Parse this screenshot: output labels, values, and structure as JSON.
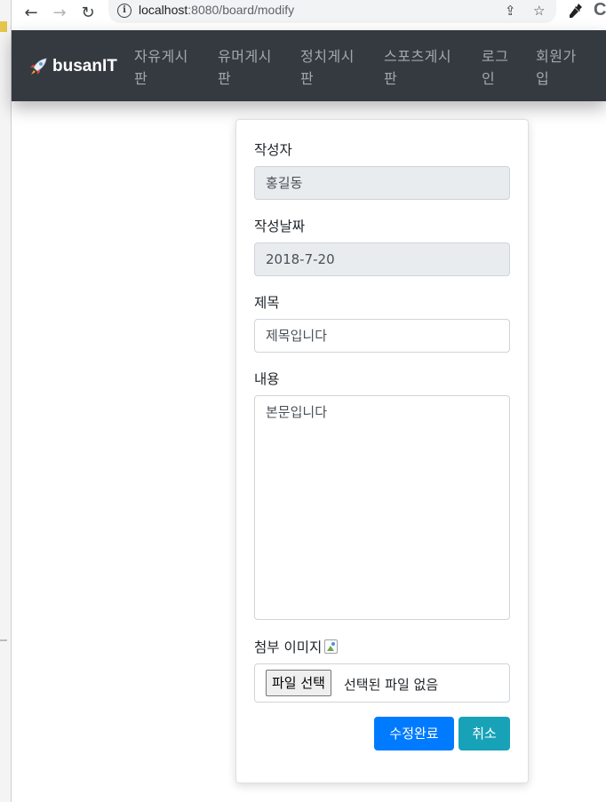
{
  "browser": {
    "url_host": "localhost",
    "url_rest": ":8080/board/modify",
    "icons": [
      "back-icon",
      "forward-icon",
      "reload-icon",
      "info-icon",
      "share-icon",
      "star-icon",
      "eyedropper-icon"
    ],
    "extension_letter": "C"
  },
  "navbar": {
    "brand": "busanIT",
    "brand_icon": "rocket-icon",
    "links": [
      {
        "line1": "자유게시",
        "line2": "판"
      },
      {
        "line1": "유머게시",
        "line2": "판"
      },
      {
        "line1": "정치게시",
        "line2": "판"
      },
      {
        "line1": "스포츠게시",
        "line2": "판"
      },
      {
        "line1": "로그",
        "line2": "인"
      },
      {
        "line1": "회원가",
        "line2": "입"
      }
    ],
    "background": "#343a40"
  },
  "form": {
    "writer_label": "작성자",
    "writer_value": "홍길동",
    "date_label": "작성날짜",
    "date_value": "2018-7-20",
    "title_label": "제목",
    "title_value": "제목입니다",
    "content_label": "내용",
    "content_value": "본문입니다",
    "image_label": "첨부 이미지",
    "file_button": "파일 선택",
    "file_status": "선택된 파일 없음",
    "submit_label": "수정완료",
    "cancel_label": "취소"
  },
  "colors": {
    "primary": "#007bff",
    "info": "#17a2b8",
    "readonly_bg": "#e9ecef"
  }
}
